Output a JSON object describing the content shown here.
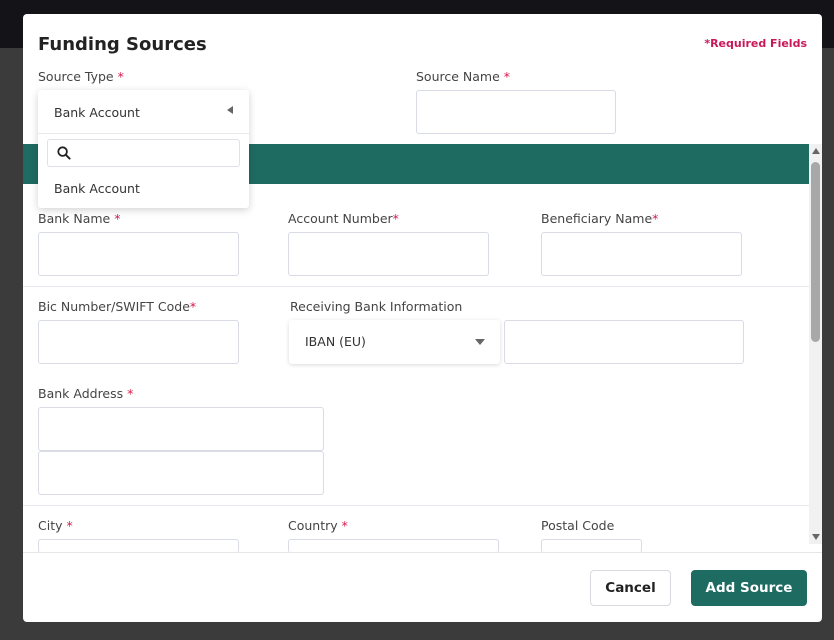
{
  "modal": {
    "title": "Funding Sources",
    "required_note": "*Required Fields"
  },
  "fields": {
    "source_type": {
      "label": "Source Type ",
      "required": "*",
      "selected": "Bank Account"
    },
    "source_name": {
      "label": "Source Name ",
      "required": "*",
      "value": ""
    },
    "bank_name": {
      "label": "Bank Name ",
      "required": "*",
      "value": ""
    },
    "account_number": {
      "label": "Account Number",
      "required": "*",
      "value": ""
    },
    "beneficiary_name": {
      "label": "Beneficiary Name",
      "required": "*",
      "value": ""
    },
    "bic_swift": {
      "label": "Bic Number/SWIFT Code",
      "required": "*",
      "value": ""
    },
    "receiving_bank": {
      "label": "Receiving Bank Information",
      "selected": "IBAN (EU)",
      "value": ""
    },
    "bank_address": {
      "label": "Bank Address ",
      "required": "*",
      "line1": "",
      "line2": ""
    },
    "city": {
      "label": "City ",
      "required": "*"
    },
    "country": {
      "label": "Country ",
      "required": "*"
    },
    "postal_code": {
      "label": "Postal Code"
    }
  },
  "dropdown": {
    "search_placeholder": "",
    "options": [
      "Bank Account"
    ]
  },
  "footer": {
    "cancel_label": "Cancel",
    "add_label": "Add Source"
  },
  "colors": {
    "accent": "#1e6b62",
    "required": "#d6184c"
  }
}
